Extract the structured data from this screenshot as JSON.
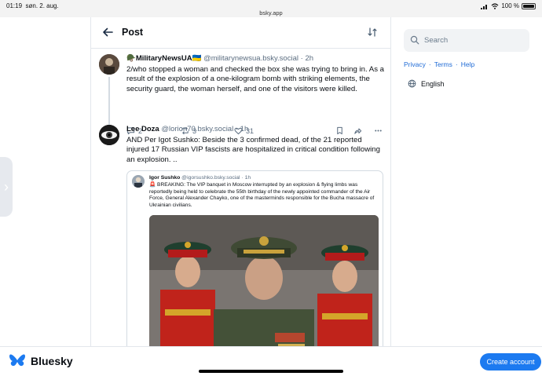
{
  "status_bar": {
    "time": "01:19",
    "date": "søn. 2. aug.",
    "url": "bsky.app",
    "battery": "100 %"
  },
  "header": {
    "title": "Post",
    "back_icon": "arrow-left-icon",
    "filter_icon": "sort-icon"
  },
  "posts": [
    {
      "author_name": "🪖MilitaryNewsUA🇺🇦",
      "handle": "@militarynewsua.bsky.social",
      "separator": "·",
      "time": "2h",
      "text": "2/who stopped a woman and checked the box she was trying to bring in. As a result of the explosion of a one-kilogram bomb with striking elements, the security guard, the woman herself, and one of the visitors were killed.",
      "replies": "2",
      "reposts": "3",
      "likes": "31"
    },
    {
      "author_name": "Lee Doza",
      "handle": "@lorion70.bsky.social",
      "separator": "·",
      "time": "1h",
      "text": "AND Per Igot Sushko: Beside the 3 confirmed dead, of the 21 reported injured 17 Russian VIP fascists are hospitalized in critical condition following an explosion. .."
    }
  ],
  "quote": {
    "author_name": "Igor Sushko",
    "handle": "@igorsushko.bsky.social",
    "separator": "·",
    "time": "1h",
    "text": "🚨 BREAKING: The VIP banquet in Moscow interrupted by an explosion & flying limbs was reportedly being held to celebrate the 55th birthday of the newly appointed commander of the Air Force, General Alexander Chayko, one of the masterminds responsible for the Bucha massacre of Ukrainian civilians."
  },
  "sidebar": {
    "search_placeholder": "Search",
    "links": [
      "Privacy",
      "Terms",
      "Help"
    ],
    "link_separator": "·",
    "language": "English"
  },
  "bottom_bar": {
    "brand": "Bluesky",
    "create_account": "Create account"
  },
  "colors": {
    "accent": "#1c7af0",
    "link": "#1f6bd6",
    "muted": "#5b6d80"
  }
}
